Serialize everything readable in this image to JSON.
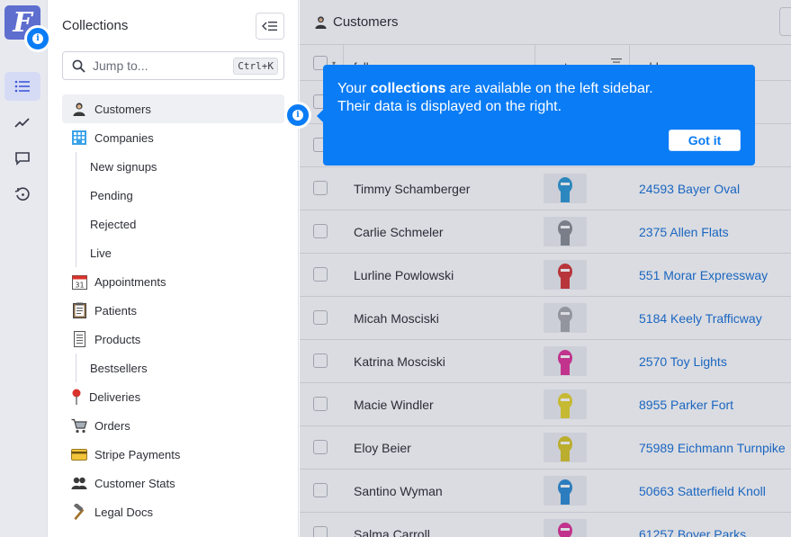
{
  "app": {
    "logo_letter": "F"
  },
  "sidebar": {
    "title": "Collections",
    "search_placeholder": "Jump to...",
    "search_shortcut": "Ctrl+K",
    "items": [
      {
        "label": "Customers",
        "icon": "customer-person-icon",
        "level": 0,
        "selected": true
      },
      {
        "label": "Companies",
        "icon": "building-icon",
        "level": 0
      },
      {
        "label": "New signups",
        "level": 1
      },
      {
        "label": "Pending",
        "level": 1
      },
      {
        "label": "Rejected",
        "level": 1
      },
      {
        "label": "Live",
        "level": 1
      },
      {
        "label": "Appointments",
        "icon": "calendar-icon",
        "level": 0
      },
      {
        "label": "Patients",
        "icon": "clipboard-icon",
        "level": 0
      },
      {
        "label": "Products",
        "icon": "list-doc-icon",
        "level": 0
      },
      {
        "label": "Bestsellers",
        "level": 1
      },
      {
        "label": "Deliveries",
        "icon": "pin-icon",
        "level": 0
      },
      {
        "label": "Orders",
        "icon": "cart-icon",
        "level": 0
      },
      {
        "label": "Stripe Payments",
        "icon": "credit-card-icon",
        "level": 0
      },
      {
        "label": "Customer Stats",
        "icon": "people-icon",
        "level": 0
      },
      {
        "label": "Legal Docs",
        "icon": "hammer-icon",
        "level": 0
      }
    ]
  },
  "main": {
    "title": "Customers",
    "columns": [
      "fullname",
      "avatar",
      "address"
    ],
    "rows": [
      {
        "name": "",
        "address": "",
        "avatar_color": "#9aa0aa"
      },
      {
        "name": "",
        "address": "",
        "avatar_color": "#9aa0aa"
      },
      {
        "name": "Timmy Schamberger",
        "address": "24593 Bayer Oval",
        "avatar_color": "#2f9ad6"
      },
      {
        "name": "Carlie Schmeler",
        "address": "2375 Allen Flats",
        "avatar_color": "#8b8f96"
      },
      {
        "name": "Lurline Powlowski",
        "address": "551 Morar Expressway",
        "avatar_color": "#d63a3a"
      },
      {
        "name": "Micah Mosciski",
        "address": "5184 Keely Trafficway",
        "avatar_color": "#a8aab0"
      },
      {
        "name": "Katrina Mosciski",
        "address": "2570 Toy Lights",
        "avatar_color": "#e0369a"
      },
      {
        "name": "Macie Windler",
        "address": "8955 Parker Fort",
        "avatar_color": "#e6d630"
      },
      {
        "name": "Eloy Beier",
        "address": "75989 Eichmann Turnpike",
        "avatar_color": "#d9c82a"
      },
      {
        "name": "Santino Wyman",
        "address": "50663 Satterfield Knoll",
        "avatar_color": "#2f8ed6"
      },
      {
        "name": "Salma Carroll",
        "address": "61257 Boyer Parks",
        "avatar_color": "#e0369a"
      }
    ]
  },
  "tooltip": {
    "line1_pre": "Your ",
    "line1_bold": "collections",
    "line1_post": " are available on the left sidebar.",
    "line2": "Their data is displayed on the right.",
    "button": "Got it"
  },
  "colors": {
    "accent": "#0a7cf5",
    "link": "#1a73d9",
    "logo": "#5e6ecf"
  }
}
